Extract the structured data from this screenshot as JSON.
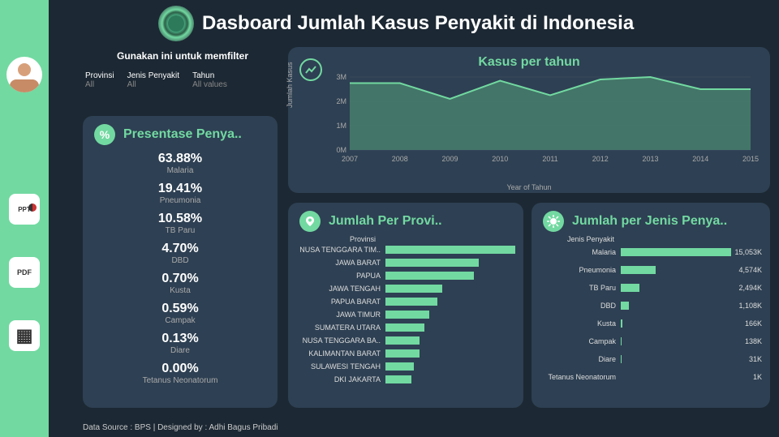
{
  "header": {
    "title": "Dasboard Jumlah Kasus Penyakit di Indonesia"
  },
  "filter": {
    "title": "Gunakan ini untuk memfilter",
    "provinsi_label": "Provinsi",
    "provinsi_value": "All",
    "jenis_label": "Jenis Penyakit",
    "jenis_value": "All",
    "tahun_label": "Tahun",
    "tahun_value": "All values"
  },
  "presentase": {
    "title": "Presentase Penya..",
    "items": [
      {
        "value": "63.88%",
        "label": "Malaria"
      },
      {
        "value": "19.41%",
        "label": "Pneumonia"
      },
      {
        "value": "10.58%",
        "label": "TB Paru"
      },
      {
        "value": "4.70%",
        "label": "DBD"
      },
      {
        "value": "0.70%",
        "label": "Kusta"
      },
      {
        "value": "0.59%",
        "label": "Campak"
      },
      {
        "value": "0.13%",
        "label": "Diare"
      },
      {
        "value": "0.00%",
        "label": "Tetanus Neonatorum"
      }
    ]
  },
  "tahun": {
    "title": "Kasus per tahun"
  },
  "provinsi": {
    "title": "Jumlah Per Provi..",
    "header": "Provinsi"
  },
  "jenis": {
    "title": "Jumlah per Jenis Penya..",
    "header": "Jenis Penyakit"
  },
  "footer": "Data Source : BPS | Designed by : Adhi Bagus Pribadi",
  "chart_data": [
    {
      "type": "area",
      "title": "Kasus per tahun",
      "xlabel": "Year of Tahun",
      "ylabel": "Jumlah Kasus",
      "x": [
        2007,
        2008,
        2009,
        2010,
        2011,
        2012,
        2013,
        2014,
        2015
      ],
      "values": [
        2750000,
        2750000,
        2100000,
        2850000,
        2250000,
        2900000,
        3000000,
        2500000,
        2500000
      ],
      "ylim": [
        0,
        3000000
      ],
      "yticks": [
        "0M",
        "1M",
        "2M",
        "3M"
      ]
    },
    {
      "type": "bar",
      "orientation": "horizontal",
      "title": "Jumlah Per Provinsi",
      "categories": [
        "NUSA TENGGARA TIM..",
        "JAWA BARAT",
        "PAPUA",
        "JAWA TENGAH",
        "PAPUA BARAT",
        "JAWA TIMUR",
        "SUMATERA UTARA",
        "NUSA TENGGARA BA..",
        "KALIMANTAN BARAT",
        "SULAWESI TENGAH",
        "DKI JAKARTA"
      ],
      "values": [
        100,
        72,
        68,
        44,
        40,
        34,
        30,
        26,
        26,
        22,
        20
      ],
      "xlim": [
        0,
        100
      ]
    },
    {
      "type": "bar",
      "orientation": "horizontal",
      "title": "Jumlah per Jenis Penyakit",
      "categories": [
        "Malaria",
        "Pneumonia",
        "TB Paru",
        "DBD",
        "Kusta",
        "Campak",
        "Diare",
        "Tetanus Neonatorum"
      ],
      "values": [
        15053,
        4574,
        2494,
        1108,
        166,
        138,
        31,
        1
      ],
      "labels": [
        "15,053K",
        "4,574K",
        "2,494K",
        "1,108K",
        "166K",
        "138K",
        "31K",
        "1K"
      ],
      "xlim": [
        0,
        15053
      ]
    }
  ]
}
